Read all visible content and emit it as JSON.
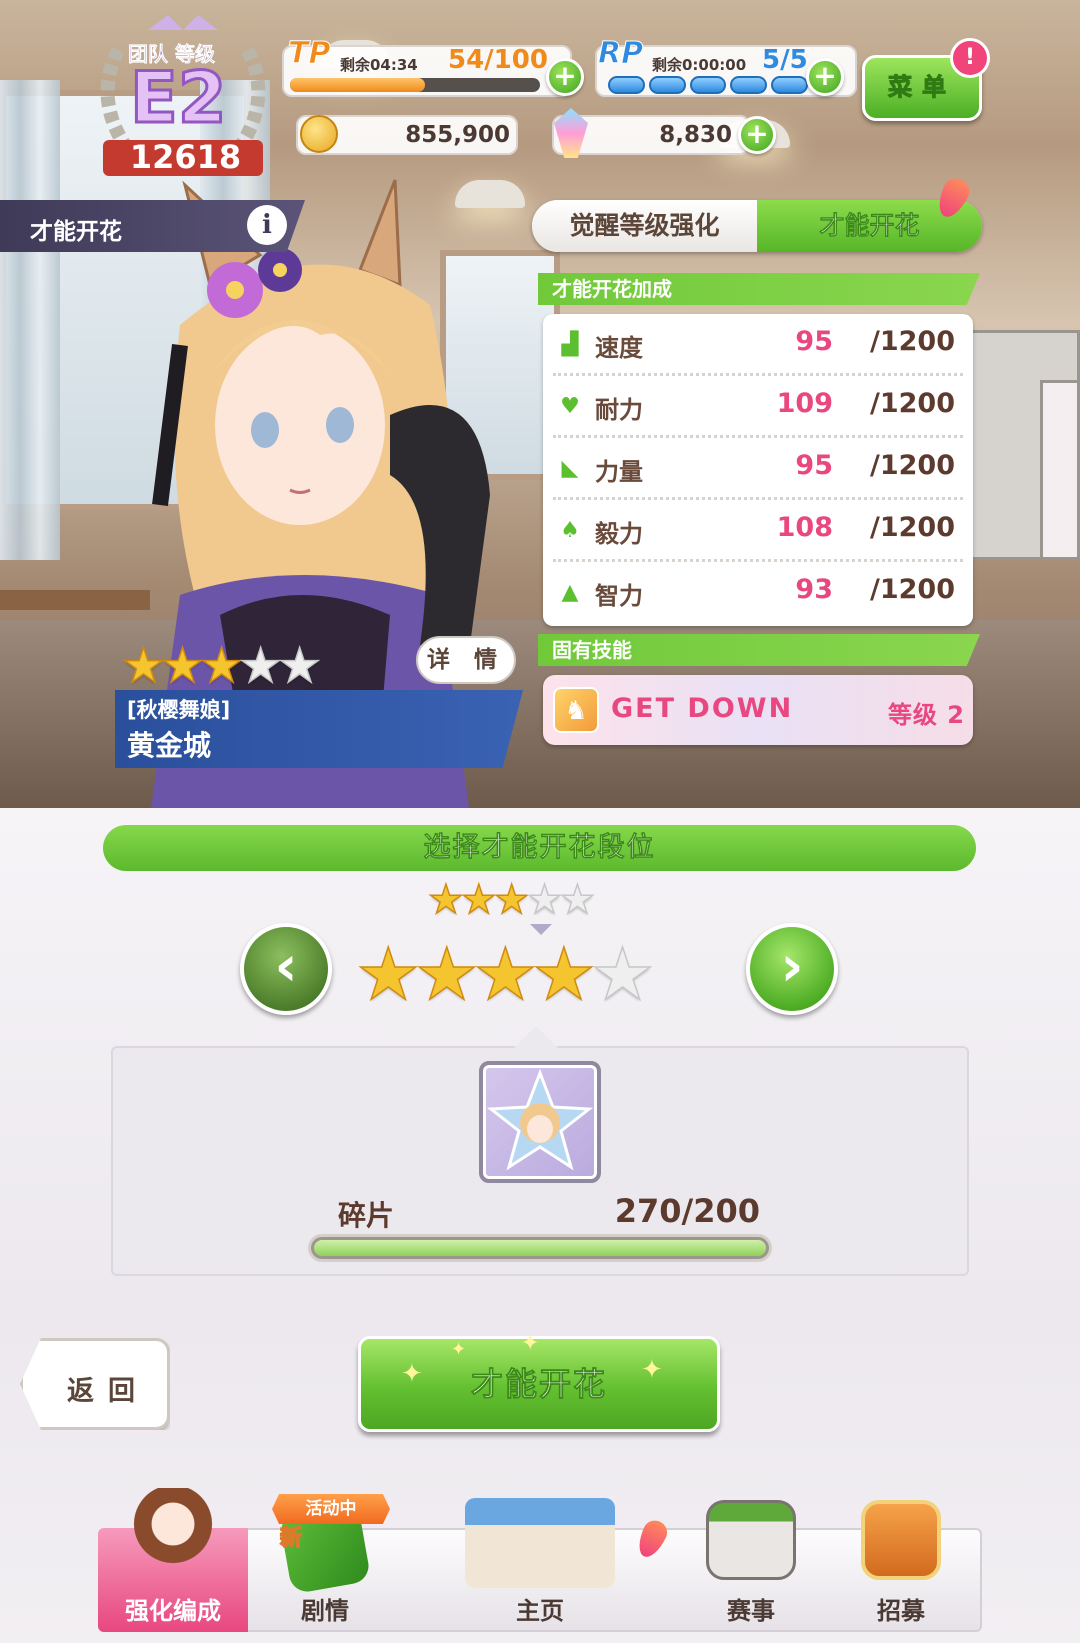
{
  "team": {
    "label": "团队 等级",
    "grade": "E2",
    "score": "12618"
  },
  "resources": {
    "tp": {
      "label": "TP",
      "timer": "剩余04:34",
      "value": "54/100",
      "fill": 0.54
    },
    "rp": {
      "label": "RP",
      "timer": "剩余0:00:00",
      "value": "5/5",
      "pips": 5
    },
    "coins": "855,900",
    "carats": "8,830"
  },
  "menu": {
    "label": "菜单",
    "badge": "!"
  },
  "page_title": "才能开花",
  "tabs": [
    {
      "label": "觉醒等级强化",
      "active": false
    },
    {
      "label": "才能开花",
      "active": true
    }
  ],
  "bonus": {
    "header": "才能开花加成",
    "stats": [
      {
        "name": "速度",
        "icon": "shoe-icon",
        "value": "95",
        "max": "/1200"
      },
      {
        "name": "耐力",
        "icon": "heart-icon",
        "value": "109",
        "max": "/1200"
      },
      {
        "name": "力量",
        "icon": "arm-icon",
        "value": "95",
        "max": "/1200"
      },
      {
        "name": "毅力",
        "icon": "flame-icon",
        "value": "108",
        "max": "/1200"
      },
      {
        "name": "智力",
        "icon": "graduation-cap-icon",
        "value": "93",
        "max": "/1200"
      }
    ]
  },
  "skill": {
    "header": "固有技能",
    "name": "GET DOWN",
    "level": "等级 2"
  },
  "character": {
    "stars": 3,
    "max_stars": 5,
    "details_label": "详 情",
    "epithet": "[秋樱舞娘]",
    "name": "黄金城"
  },
  "select": {
    "title": "选择才能开花段位",
    "current_stars": 3,
    "target_stars": 4,
    "max_stars": 5
  },
  "shards": {
    "label": "碎片",
    "count": "270/200",
    "fill": 1.0
  },
  "buttons": {
    "back": "返回",
    "bloom": "才能开花"
  },
  "nav": {
    "event_tag": "活动中",
    "new_tag": "新",
    "items": [
      {
        "label": "强化编成",
        "active": true
      },
      {
        "label": "剧情",
        "active": false
      },
      {
        "label": "主页",
        "active": false
      },
      {
        "label": "赛事",
        "active": false
      },
      {
        "label": "招募",
        "active": false
      }
    ]
  },
  "colors": {
    "accent_green": "#5cb92d",
    "value_pink": "#e8477f",
    "text_brown": "#5c3b2e",
    "tp_orange": "#f08a1a",
    "rp_blue": "#2f8ae0"
  }
}
